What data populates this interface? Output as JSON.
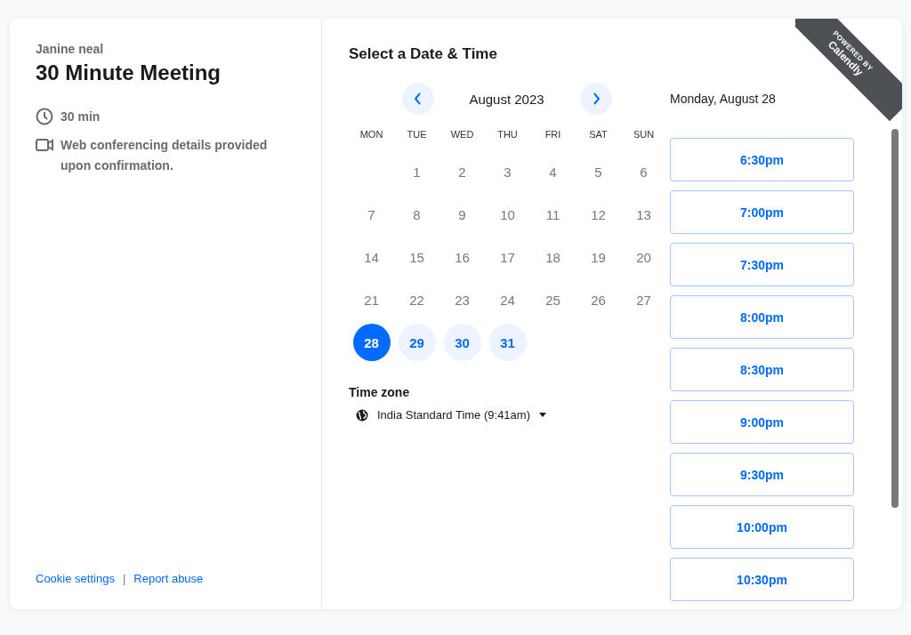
{
  "host": {
    "name": "Janine neal"
  },
  "event": {
    "title": "30 Minute Meeting",
    "duration": "30 min",
    "location": "Web conferencing details provided upon confirmation."
  },
  "footer_links": [
    "Cookie settings",
    "Report abuse"
  ],
  "footer_separator": "|",
  "ribbon": {
    "caption": "POWERED BY",
    "brand": "Calendly"
  },
  "calendar": {
    "heading": "Select a Date & Time",
    "month": "August 2023",
    "weekdays": [
      "MON",
      "TUE",
      "WED",
      "THU",
      "FRI",
      "SAT",
      "SUN"
    ],
    "weeks": [
      [
        {
          "kind": "blank"
        },
        {
          "kind": "day",
          "label": "1",
          "available": false,
          "selected": false
        },
        {
          "kind": "day",
          "label": "2",
          "available": false,
          "selected": false
        },
        {
          "kind": "day",
          "label": "3",
          "available": false,
          "selected": false
        },
        {
          "kind": "day",
          "label": "4",
          "available": false,
          "selected": false
        },
        {
          "kind": "day",
          "label": "5",
          "available": false,
          "selected": false
        },
        {
          "kind": "day",
          "label": "6",
          "available": false,
          "selected": false
        }
      ],
      [
        {
          "kind": "day",
          "label": "7",
          "available": false,
          "selected": false
        },
        {
          "kind": "day",
          "label": "8",
          "available": false,
          "selected": false
        },
        {
          "kind": "day",
          "label": "9",
          "available": false,
          "selected": false
        },
        {
          "kind": "day",
          "label": "10",
          "available": false,
          "selected": false
        },
        {
          "kind": "day",
          "label": "11",
          "available": false,
          "selected": false
        },
        {
          "kind": "day",
          "label": "12",
          "available": false,
          "selected": false
        },
        {
          "kind": "day",
          "label": "13",
          "available": false,
          "selected": false
        }
      ],
      [
        {
          "kind": "day",
          "label": "14",
          "available": false,
          "selected": false
        },
        {
          "kind": "day",
          "label": "15",
          "available": false,
          "selected": false
        },
        {
          "kind": "day",
          "label": "16",
          "available": false,
          "selected": false
        },
        {
          "kind": "day",
          "label": "17",
          "available": false,
          "selected": false
        },
        {
          "kind": "day",
          "label": "18",
          "available": false,
          "selected": false
        },
        {
          "kind": "day",
          "label": "19",
          "available": false,
          "selected": false
        },
        {
          "kind": "day",
          "label": "20",
          "available": false,
          "selected": false
        }
      ],
      [
        {
          "kind": "day",
          "label": "21",
          "available": false,
          "selected": false
        },
        {
          "kind": "day",
          "label": "22",
          "available": false,
          "selected": false
        },
        {
          "kind": "day",
          "label": "23",
          "available": false,
          "selected": false
        },
        {
          "kind": "day",
          "label": "24",
          "available": false,
          "selected": false
        },
        {
          "kind": "day",
          "label": "25",
          "available": false,
          "selected": false
        },
        {
          "kind": "day",
          "label": "26",
          "available": false,
          "selected": false
        },
        {
          "kind": "day",
          "label": "27",
          "available": false,
          "selected": false
        }
      ],
      [
        {
          "kind": "day",
          "label": "28",
          "available": true,
          "selected": true
        },
        {
          "kind": "day",
          "label": "29",
          "available": true,
          "selected": false
        },
        {
          "kind": "day",
          "label": "30",
          "available": true,
          "selected": false
        },
        {
          "kind": "day",
          "label": "31",
          "available": true,
          "selected": false
        }
      ]
    ]
  },
  "time_zone": {
    "label": "Time zone",
    "value": "India Standard Time (9:41am)"
  },
  "slots": {
    "date": "Monday, August 28",
    "times": [
      "6:30pm",
      "7:00pm",
      "7:30pm",
      "8:00pm",
      "8:30pm",
      "9:00pm",
      "9:30pm",
      "10:00pm",
      "10:30pm"
    ]
  }
}
